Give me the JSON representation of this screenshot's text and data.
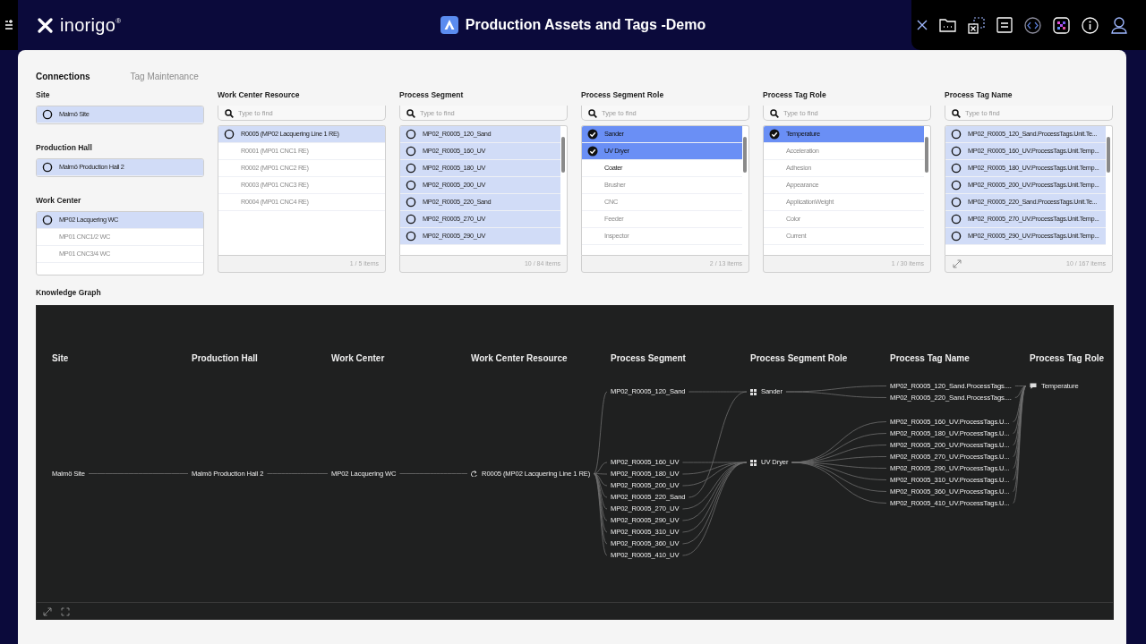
{
  "app": {
    "logo": "inorigo$^{®}$",
    "title": "Production Assets and Tags -Demo"
  },
  "tabs": [
    {
      "label": "Connections",
      "selected": true
    },
    {
      "label": "Tag Maintenance",
      "selected": false
    }
  ],
  "filters": [
    {
      "kind": "stack",
      "sections": [
        {
          "title": "Site",
          "items": [
            {
              "label": "Malmö Site",
              "selected": true,
              "dimmed": false
            }
          ]
        },
        {
          "title": "Production Hall",
          "items": [
            {
              "label": "Malmö Production Hall 2",
              "selected": true,
              "dimmed": false
            }
          ]
        },
        {
          "title": "Work Center",
          "items": [
            {
              "label": "MP02 Lacquering WC",
              "selected": true,
              "dimmed": false
            },
            {
              "label": "MP01 CNC1/2 WC",
              "selected": false,
              "dimmed": true
            },
            {
              "label": "MP01 CNC3/4 WC",
              "selected": false,
              "dimmed": true
            }
          ]
        }
      ]
    },
    {
      "kind": "list",
      "title": "Work Center Resource",
      "placeholder": "Type to find",
      "multi_select": false,
      "scrollbar": false,
      "expandable": false,
      "count": "1 / 5 items",
      "items": [
        {
          "label": "R0005 (MP02 Lacquering Line 1 RE)",
          "selected": true,
          "dimmed": false
        },
        {
          "label": "R0001 (MP01 CNC1 RE)",
          "selected": false,
          "dimmed": true
        },
        {
          "label": "R0002 (MP01 CNC2 RE)",
          "selected": false,
          "dimmed": true
        },
        {
          "label": "R0003 (MP01 CNC3 RE)",
          "selected": false,
          "dimmed": true
        },
        {
          "label": "R0004 (MP01 CNC4 RE)",
          "selected": false,
          "dimmed": true
        }
      ]
    },
    {
      "kind": "list",
      "title": "Process Segment",
      "placeholder": "Type to find",
      "multi_select": false,
      "scrollbar": true,
      "expandable": false,
      "count": "10 / 84 items",
      "items": [
        {
          "label": "MP02_R0005_120_Sand",
          "selected": true,
          "dimmed": false
        },
        {
          "label": "MP02_R0005_160_UV",
          "selected": true,
          "dimmed": false
        },
        {
          "label": "MP02_R0005_180_UV",
          "selected": true,
          "dimmed": false
        },
        {
          "label": "MP02_R0005_200_UV",
          "selected": true,
          "dimmed": false
        },
        {
          "label": "MP02_R0005_220_Sand",
          "selected": true,
          "dimmed": false
        },
        {
          "label": "MP02_R0005_270_UV",
          "selected": true,
          "dimmed": false
        },
        {
          "label": "MP02_R0005_290_UV",
          "selected": true,
          "dimmed": false
        }
      ]
    },
    {
      "kind": "list",
      "title": "Process Segment Role",
      "placeholder": "Type to find",
      "multi_select": true,
      "scrollbar": true,
      "expandable": false,
      "count": "2 / 13 items",
      "items": [
        {
          "label": "Sander",
          "selected": true,
          "dimmed": false
        },
        {
          "label": "UV Dryer",
          "selected": true,
          "dimmed": false
        },
        {
          "label": "Coater",
          "selected": false,
          "dimmed": false
        },
        {
          "label": "Brusher",
          "selected": false,
          "dimmed": true
        },
        {
          "label": "CNC",
          "selected": false,
          "dimmed": true
        },
        {
          "label": "Feeder",
          "selected": false,
          "dimmed": true
        },
        {
          "label": "Inspector",
          "selected": false,
          "dimmed": true
        }
      ]
    },
    {
      "kind": "list",
      "title": "Process Tag Role",
      "placeholder": "Type to find",
      "multi_select": true,
      "scrollbar": true,
      "expandable": false,
      "count": "1 / 30 items",
      "items": [
        {
          "label": "Temperature",
          "selected": true,
          "dimmed": false
        },
        {
          "label": "Acceleration",
          "selected": false,
          "dimmed": true
        },
        {
          "label": "Adhesion",
          "selected": false,
          "dimmed": true
        },
        {
          "label": "Appearance",
          "selected": false,
          "dimmed": true
        },
        {
          "label": "ApplicationWeight",
          "selected": false,
          "dimmed": true
        },
        {
          "label": "Color",
          "selected": false,
          "dimmed": true
        },
        {
          "label": "Current",
          "selected": false,
          "dimmed": true
        }
      ]
    },
    {
      "kind": "list",
      "title": "Process Tag Name",
      "placeholder": "Type to find",
      "multi_select": false,
      "scrollbar": true,
      "expandable": true,
      "count": "10 / 167 items",
      "items": [
        {
          "label": "MP02_R0005_120_Sand.ProcessTags.Unit.Te...",
          "selected": true,
          "dimmed": false
        },
        {
          "label": "MP02_R0005_160_UV.ProcessTags.Unit.Temp...",
          "selected": true,
          "dimmed": false
        },
        {
          "label": "MP02_R0005_180_UV.ProcessTags.Unit.Temp...",
          "selected": true,
          "dimmed": false
        },
        {
          "label": "MP02_R0005_200_UV.ProcessTags.Unit.Temp...",
          "selected": true,
          "dimmed": false
        },
        {
          "label": "MP02_R0005_220_Sand.ProcessTags.Unit.Te...",
          "selected": true,
          "dimmed": false
        },
        {
          "label": "MP02_R0005_270_UV.ProcessTags.Unit.Temp...",
          "selected": true,
          "dimmed": false
        },
        {
          "label": "MP02_R0005_290_UV.ProcessTags.Unit.Temp...",
          "selected": true,
          "dimmed": false
        }
      ]
    }
  ],
  "graph": {
    "title": "Knowledge Graph",
    "columns": [
      "Site",
      "Production Hall",
      "Work Center",
      "Work Center Resource",
      "Process Segment",
      "Process Segment Role",
      "Process Tag Name",
      "Process Tag Role"
    ],
    "chain": [
      {
        "label": "Malmö Site",
        "kind": "plain"
      },
      {
        "label": "Malmö Production Hall 2",
        "kind": "plain"
      },
      {
        "label": "MP02 Lacquering WC",
        "kind": "plain"
      },
      {
        "label": "R0005 (MP02 Lacquering Line 1 RE)",
        "kind": "resource"
      }
    ],
    "segments": [
      {
        "nodes": [
          {
            "label": "MP02_R0005_120_Sand",
            "kind": "sander"
          }
        ]
      },
      {
        "nodes": [
          {
            "label": "MP02_R0005_160_UV",
            "kind": "dryer"
          },
          {
            "label": "MP02_R0005_180_UV",
            "kind": "dryer"
          },
          {
            "label": "MP02_R0005_200_UV",
            "kind": "dryer"
          },
          {
            "label": "MP02_R0005_220_Sand",
            "kind": "sander"
          },
          {
            "label": "MP02_R0005_270_UV",
            "kind": "dryer"
          },
          {
            "label": "MP02_R0005_290_UV",
            "kind": "dryer"
          },
          {
            "label": "MP02_R0005_310_UV",
            "kind": "dryer"
          },
          {
            "label": "MP02_R0005_360_UV",
            "kind": "dryer"
          },
          {
            "label": "MP02_R0005_410_UV",
            "kind": "dryer"
          }
        ]
      }
    ],
    "roles": [
      {
        "label": "Sander",
        "kind": "sander"
      },
      {
        "label": "UV Dryer",
        "kind": "dryer"
      }
    ],
    "tags": [
      {
        "label": "MP02_R0005_120_Sand.ProcessTags....",
        "kind": "sander"
      },
      {
        "label": "MP02_R0005_220_Sand.ProcessTags....",
        "kind": "sander"
      },
      {
        "label": "MP02_R0005_160_UV.ProcessTags.U...",
        "kind": "dryer"
      },
      {
        "label": "MP02_R0005_180_UV.ProcessTags.U...",
        "kind": "dryer"
      },
      {
        "label": "MP02_R0005_200_UV.ProcessTags.U...",
        "kind": "dryer"
      },
      {
        "label": "MP02_R0005_270_UV.ProcessTags.U...",
        "kind": "dryer"
      },
      {
        "label": "MP02_R0005_290_UV.ProcessTags.U...",
        "kind": "dryer"
      },
      {
        "label": "MP02_R0005_310_UV.ProcessTags.U...",
        "kind": "dryer"
      },
      {
        "label": "MP02_R0005_360_UV.ProcessTags.U...",
        "kind": "dryer"
      },
      {
        "label": "MP02_R0005_410_UV.ProcessTags.U...",
        "kind": "dryer"
      }
    ],
    "tag_role": {
      "label": "Temperature"
    }
  }
}
